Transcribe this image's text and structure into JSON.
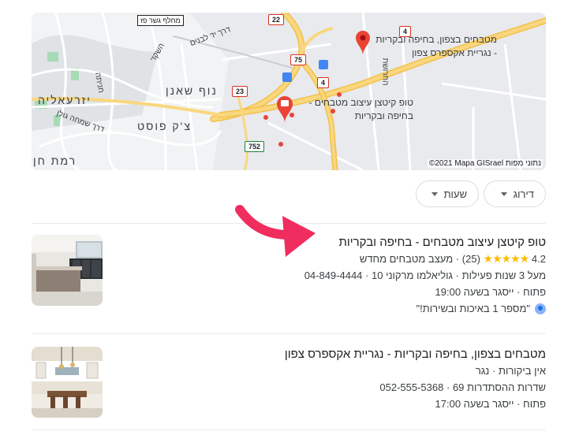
{
  "map": {
    "tag_label": "מחלף גשר פז",
    "place_labels": {
      "yizraelia": "יזרעאליה",
      "noff_shanan": "נוף שאנן",
      "tsak_post": "צ'ק פוסט",
      "ramat_chen": "רמת חן",
      "hanita": "חניתה",
      "hashaked": "השקד",
      "derech_hayam": "דרך יד לבנים",
      "hacharoshet": "החרושת",
      "simcha_golan": "דרך שמחה גולן"
    },
    "shields": [
      "22",
      "4",
      "75",
      "4",
      "23",
      "752"
    ],
    "pin_top_label": "מטבחים בצפון, בחיפה ובקריות - נגריית אקספרס צפון",
    "pin_main_label": "טופ קיטצן עיצוב מטבחים - בחיפה ובקריות",
    "attribution": "©2021 Mapa GISrael נתוני מפות"
  },
  "filters": {
    "rating_label": "דירוג",
    "hours_label": "שעות"
  },
  "listings": [
    {
      "name": "טופ קיטצן עיצוב מטבחים - בחיפה ובקריות",
      "rating": "4.2",
      "stars": "★★★★★",
      "reviews": "(25)",
      "category": "מעצב מטבחים מחדש",
      "years": "מעל 3 שנות פעילות",
      "address": "גוליאלמו מרקוני 10",
      "phone": "04-849-4444",
      "status": "פתוח",
      "closes": "ייסגר בשעה 19:00",
      "quote": "\"מספר 1 באיכות ובשירות!\""
    },
    {
      "name": "מטבחים בצפון, בחיפה ובקריות - נגריית אקספרס צפון",
      "no_reviews": "אין ביקורות",
      "category": "נגר",
      "address": "שדרות ההסתדרות 69",
      "phone": "052-555-5368",
      "status": "פתוח",
      "closes": "ייסגר בשעה 17:00"
    }
  ],
  "separator": "·",
  "colors": {
    "road": "#f9d77e",
    "highway": "#f3c04a",
    "pin": "#ea4335",
    "arrow": "#ef2d5e",
    "star": "#fbbc04"
  }
}
